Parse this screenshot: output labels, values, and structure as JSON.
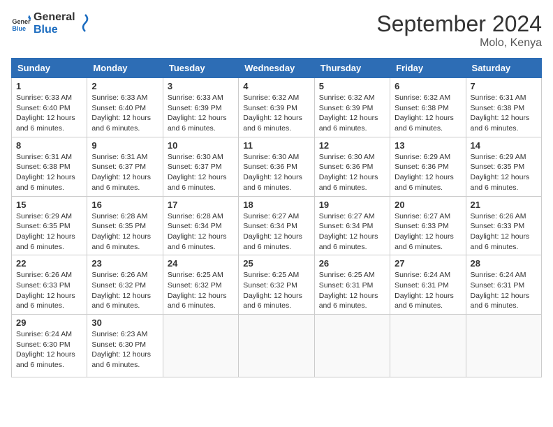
{
  "header": {
    "logo_general": "General",
    "logo_blue": "Blue",
    "month_title": "September 2024",
    "location": "Molo, Kenya"
  },
  "days_of_week": [
    "Sunday",
    "Monday",
    "Tuesday",
    "Wednesday",
    "Thursday",
    "Friday",
    "Saturday"
  ],
  "weeks": [
    [
      {
        "day": "1",
        "sunrise": "6:33 AM",
        "sunset": "6:40 PM",
        "daylight": "12 hours and 6 minutes."
      },
      {
        "day": "2",
        "sunrise": "6:33 AM",
        "sunset": "6:40 PM",
        "daylight": "12 hours and 6 minutes."
      },
      {
        "day": "3",
        "sunrise": "6:33 AM",
        "sunset": "6:39 PM",
        "daylight": "12 hours and 6 minutes."
      },
      {
        "day": "4",
        "sunrise": "6:32 AM",
        "sunset": "6:39 PM",
        "daylight": "12 hours and 6 minutes."
      },
      {
        "day": "5",
        "sunrise": "6:32 AM",
        "sunset": "6:39 PM",
        "daylight": "12 hours and 6 minutes."
      },
      {
        "day": "6",
        "sunrise": "6:32 AM",
        "sunset": "6:38 PM",
        "daylight": "12 hours and 6 minutes."
      },
      {
        "day": "7",
        "sunrise": "6:31 AM",
        "sunset": "6:38 PM",
        "daylight": "12 hours and 6 minutes."
      }
    ],
    [
      {
        "day": "8",
        "sunrise": "6:31 AM",
        "sunset": "6:38 PM",
        "daylight": "12 hours and 6 minutes."
      },
      {
        "day": "9",
        "sunrise": "6:31 AM",
        "sunset": "6:37 PM",
        "daylight": "12 hours and 6 minutes."
      },
      {
        "day": "10",
        "sunrise": "6:30 AM",
        "sunset": "6:37 PM",
        "daylight": "12 hours and 6 minutes."
      },
      {
        "day": "11",
        "sunrise": "6:30 AM",
        "sunset": "6:36 PM",
        "daylight": "12 hours and 6 minutes."
      },
      {
        "day": "12",
        "sunrise": "6:30 AM",
        "sunset": "6:36 PM",
        "daylight": "12 hours and 6 minutes."
      },
      {
        "day": "13",
        "sunrise": "6:29 AM",
        "sunset": "6:36 PM",
        "daylight": "12 hours and 6 minutes."
      },
      {
        "day": "14",
        "sunrise": "6:29 AM",
        "sunset": "6:35 PM",
        "daylight": "12 hours and 6 minutes."
      }
    ],
    [
      {
        "day": "15",
        "sunrise": "6:29 AM",
        "sunset": "6:35 PM",
        "daylight": "12 hours and 6 minutes."
      },
      {
        "day": "16",
        "sunrise": "6:28 AM",
        "sunset": "6:35 PM",
        "daylight": "12 hours and 6 minutes."
      },
      {
        "day": "17",
        "sunrise": "6:28 AM",
        "sunset": "6:34 PM",
        "daylight": "12 hours and 6 minutes."
      },
      {
        "day": "18",
        "sunrise": "6:27 AM",
        "sunset": "6:34 PM",
        "daylight": "12 hours and 6 minutes."
      },
      {
        "day": "19",
        "sunrise": "6:27 AM",
        "sunset": "6:34 PM",
        "daylight": "12 hours and 6 minutes."
      },
      {
        "day": "20",
        "sunrise": "6:27 AM",
        "sunset": "6:33 PM",
        "daylight": "12 hours and 6 minutes."
      },
      {
        "day": "21",
        "sunrise": "6:26 AM",
        "sunset": "6:33 PM",
        "daylight": "12 hours and 6 minutes."
      }
    ],
    [
      {
        "day": "22",
        "sunrise": "6:26 AM",
        "sunset": "6:33 PM",
        "daylight": "12 hours and 6 minutes."
      },
      {
        "day": "23",
        "sunrise": "6:26 AM",
        "sunset": "6:32 PM",
        "daylight": "12 hours and 6 minutes."
      },
      {
        "day": "24",
        "sunrise": "6:25 AM",
        "sunset": "6:32 PM",
        "daylight": "12 hours and 6 minutes."
      },
      {
        "day": "25",
        "sunrise": "6:25 AM",
        "sunset": "6:32 PM",
        "daylight": "12 hours and 6 minutes."
      },
      {
        "day": "26",
        "sunrise": "6:25 AM",
        "sunset": "6:31 PM",
        "daylight": "12 hours and 6 minutes."
      },
      {
        "day": "27",
        "sunrise": "6:24 AM",
        "sunset": "6:31 PM",
        "daylight": "12 hours and 6 minutes."
      },
      {
        "day": "28",
        "sunrise": "6:24 AM",
        "sunset": "6:31 PM",
        "daylight": "12 hours and 6 minutes."
      }
    ],
    [
      {
        "day": "29",
        "sunrise": "6:24 AM",
        "sunset": "6:30 PM",
        "daylight": "12 hours and 6 minutes."
      },
      {
        "day": "30",
        "sunrise": "6:23 AM",
        "sunset": "6:30 PM",
        "daylight": "12 hours and 6 minutes."
      },
      null,
      null,
      null,
      null,
      null
    ]
  ]
}
